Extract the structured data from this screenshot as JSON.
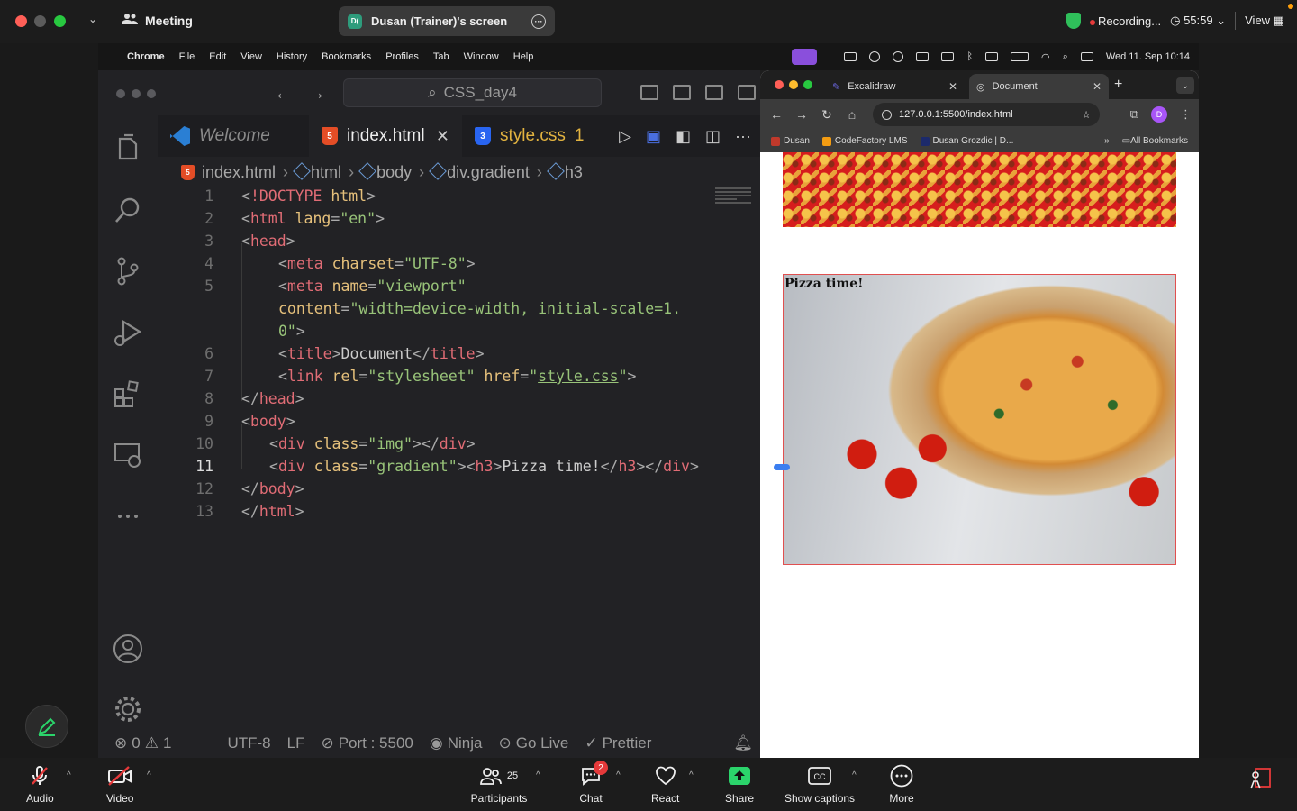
{
  "zoom": {
    "meeting_label": "Meeting",
    "share_badge": "D(",
    "share_label": "Dusan (Trainer)'s screen",
    "recording_label": "Recording...",
    "timer": "55:59",
    "view_label": "View",
    "bottom": {
      "audio": "Audio",
      "video": "Video",
      "participants": "Participants",
      "participants_count": "25",
      "chat": "Chat",
      "chat_badge": "2",
      "react": "React",
      "share": "Share",
      "captions": "Show captions",
      "more": "More"
    }
  },
  "macos": {
    "app": "Chrome",
    "menus": [
      "File",
      "Edit",
      "View",
      "History",
      "Bookmarks",
      "Profiles",
      "Tab",
      "Window",
      "Help"
    ],
    "clock": "Wed 11. Sep  10:14"
  },
  "vscode": {
    "search": "CSS_day4",
    "tabs": [
      {
        "label": "Welcome"
      },
      {
        "label": "index.html"
      },
      {
        "label": "style.css",
        "problems": "1"
      }
    ],
    "breadcrumb": [
      "index.html",
      "html",
      "body",
      "div.gradient",
      "h3"
    ],
    "line_numbers": [
      "1",
      "2",
      "3",
      "4",
      "5",
      "",
      "",
      "6",
      "7",
      "8",
      "9",
      "10",
      "11",
      "12",
      "13"
    ],
    "current_line": "11",
    "status": {
      "errors": "0",
      "warnings": "1",
      "encoding": "UTF-8",
      "eol": "LF",
      "port": "Port : 5500",
      "ninja": "Ninja",
      "golive": "Go Live",
      "prettier": "Prettier"
    }
  },
  "chrome": {
    "tabs": [
      {
        "label": "Excalidraw"
      },
      {
        "label": "Document"
      }
    ],
    "url": "127.0.0.1:5500/index.html",
    "bookmarks": [
      "Dusan",
      "CodeFactory LMS",
      "Dusan Grozdic | D..."
    ],
    "all_bookmarks": "All Bookmarks",
    "avatar_letter": "D",
    "page": {
      "heading": "Pizza time!"
    }
  },
  "colors": {
    "recording_dot": "#e53a3a",
    "shield": "#2fbf5a",
    "share_green": "#2bd46b",
    "muted_red": "#e5393a",
    "html_icon": "#e44d26",
    "css_icon": "#2965f1"
  }
}
